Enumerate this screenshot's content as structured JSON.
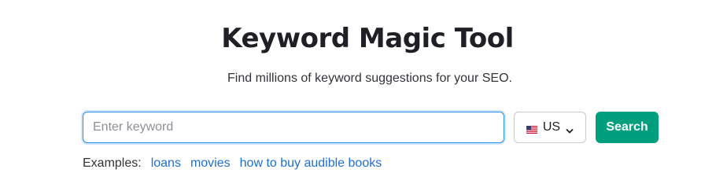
{
  "header": {
    "title": "Keyword Magic Tool",
    "subtitle": "Find millions of keyword suggestions for your SEO."
  },
  "search": {
    "placeholder": "Enter keyword",
    "value": "",
    "country": "US",
    "country_flag_icon": "us-flag-icon",
    "dropdown_icon": "chevron-down-icon",
    "button_label": "Search"
  },
  "examples": {
    "label": "Examples:",
    "items": [
      "loans",
      "movies",
      "how to buy audible books"
    ]
  },
  "colors": {
    "accent": "#00a07e",
    "link": "#1f6fd1",
    "focus_border": "#2b8ff0"
  }
}
